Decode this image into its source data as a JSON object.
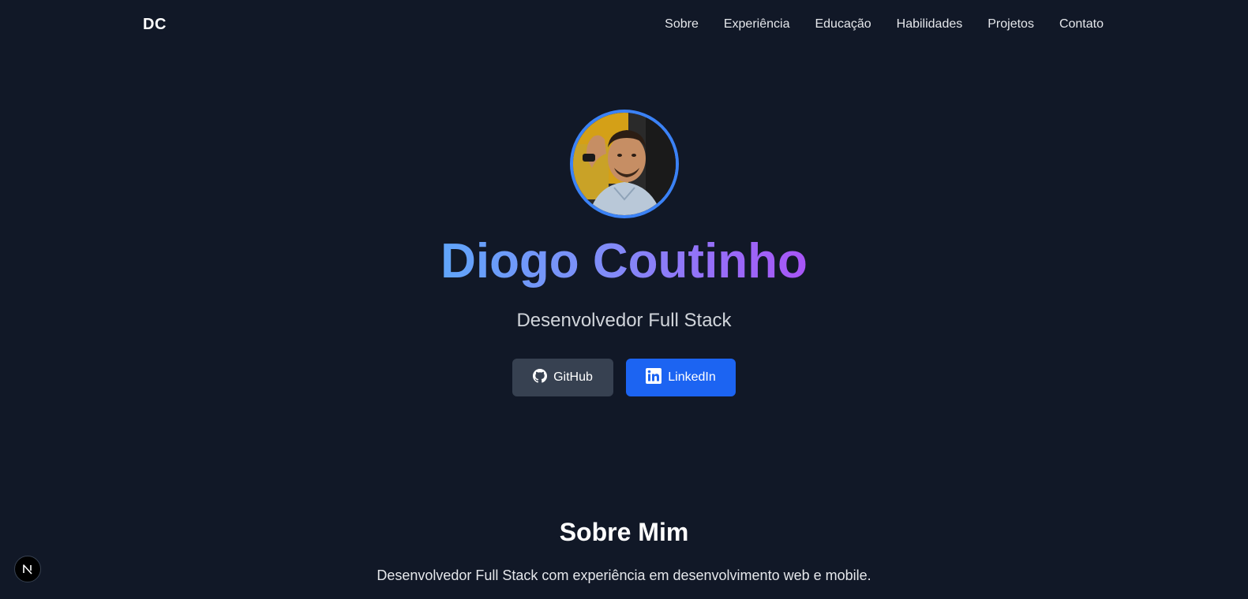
{
  "navbar": {
    "logo": "DC",
    "links": [
      {
        "label": "Sobre"
      },
      {
        "label": "Experiência"
      },
      {
        "label": "Educação"
      },
      {
        "label": "Habilidades"
      },
      {
        "label": "Projetos"
      },
      {
        "label": "Contato"
      }
    ]
  },
  "hero": {
    "name": "Diogo Coutinho",
    "subtitle": "Desenvolvedor Full Stack",
    "buttons": {
      "github": {
        "label": "GitHub",
        "icon": "github-icon"
      },
      "linkedin": {
        "label": "LinkedIn",
        "icon": "linkedin-icon"
      }
    }
  },
  "about": {
    "title": "Sobre Mim",
    "text": "Desenvolvedor Full Stack com experiência em desenvolvimento web e mobile."
  },
  "badge": {
    "icon": "nextjs-icon",
    "letter": "N"
  },
  "colors": {
    "background": "#111827",
    "accent_blue": "#3b82f6",
    "linkedin_blue": "#1c64f2",
    "github_gray": "#374151",
    "gradient_start": "#60a5fa",
    "gradient_end": "#a855f7"
  }
}
